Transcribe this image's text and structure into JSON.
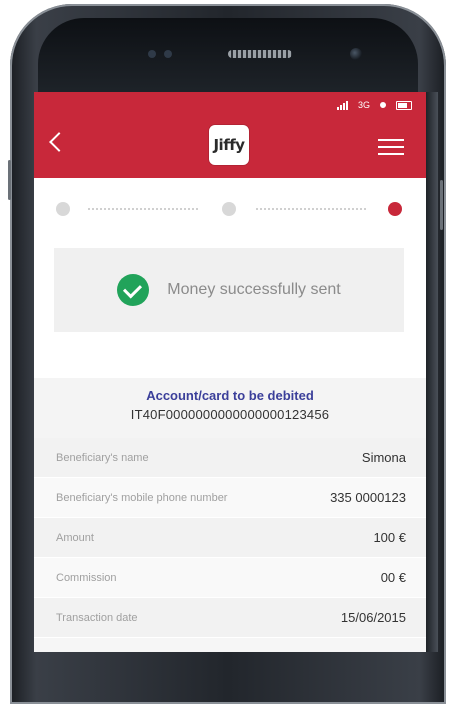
{
  "status_bar": {
    "network": "3G"
  },
  "header": {
    "back_icon": "chevron-left-icon",
    "logo_text": "Jiffy",
    "menu_icon": "hamburger-menu-icon",
    "background_color": "#c8283a"
  },
  "stepper": {
    "steps": 3,
    "current_step": 3,
    "active_color": "#c8283a",
    "inactive_color": "#d8d8d8"
  },
  "success": {
    "icon": "check-circle-icon",
    "icon_color": "#21a35a",
    "message": "Money successfully sent"
  },
  "account": {
    "title": "Account/card to be debited",
    "iban": "IT40F0000000000000000123456"
  },
  "details": [
    {
      "label": "Beneficiary's name",
      "value": "Simona"
    },
    {
      "label": "Beneficiary's mobile phone number",
      "value": "335 0000123"
    },
    {
      "label": "Amount",
      "value": "100 €"
    },
    {
      "label": "Commission",
      "value": "00 €"
    },
    {
      "label": "Transaction date",
      "value": "15/06/2015"
    }
  ]
}
